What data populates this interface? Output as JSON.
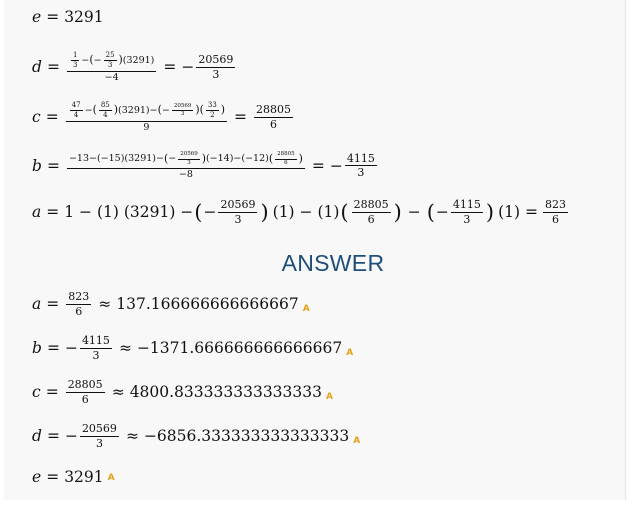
{
  "steps": {
    "e": {
      "var": "e",
      "value": "3291"
    },
    "d": {
      "var": "d",
      "num_a": "1",
      "num_a_den": "3",
      "minus": "−",
      "num_b_frac_num": "25",
      "num_b_frac_den": "3",
      "num_c": "(3291)",
      "den": "−4",
      "result_sign": "−",
      "result_num": "20569",
      "result_den": "3"
    },
    "c": {
      "var": "c",
      "t1_num": "47",
      "t1_den": "4",
      "t2_num": "85",
      "t2_den": "4",
      "t3": "(3291)",
      "t4_num": "20569",
      "t4_den": "3",
      "t5_num": "33",
      "t5_den": "2",
      "den": "9",
      "result_num": "28805",
      "result_den": "6"
    },
    "b": {
      "var": "b",
      "t1": "−13−(−15)(3291)−",
      "t2_num": "20569",
      "t2_den": "3",
      "t3": "(−14)−(−12)",
      "t4_num": "28805",
      "t4_den": "6",
      "den": "−8",
      "result_num": "4115",
      "result_den": "3"
    },
    "a": {
      "var": "a",
      "t1": "1 − (1) (3291) −",
      "t2_num": "20569",
      "t2_den": "3",
      "t3": "(1) − (1)",
      "t4_num": "28805",
      "t4_den": "6",
      "t5": "−",
      "t6_num": "4115",
      "t6_den": "3",
      "t7": "(1) =",
      "result_num": "823",
      "result_den": "6"
    }
  },
  "answer": {
    "heading": "ANSWER",
    "badge_label": "A",
    "rows": [
      {
        "var": "a",
        "sign": "",
        "num": "823",
        "den": "6",
        "approx": "137.166666666666667"
      },
      {
        "var": "b",
        "sign": "−",
        "num": "4115",
        "den": "3",
        "approx": "−1371.666666666666667"
      },
      {
        "var": "c",
        "sign": "",
        "num": "28805",
        "den": "6",
        "approx": "4800.833333333333333"
      },
      {
        "var": "d",
        "sign": "−",
        "num": "20569",
        "den": "3",
        "approx": "−6856.333333333333333"
      }
    ],
    "e_row": {
      "var": "e",
      "value": "3291"
    }
  },
  "colors": {
    "heading": "#1f4e79",
    "badge": "#e3a21a",
    "panel": "#f8f8f8"
  }
}
